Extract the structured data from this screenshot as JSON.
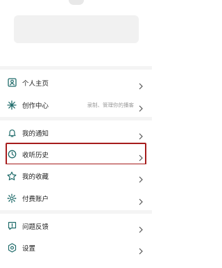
{
  "menu": {
    "items": [
      {
        "label": "个人主页",
        "sub": "",
        "icon": "profile-icon"
      },
      {
        "label": "创作中心",
        "sub": "录制、管理你的播客",
        "icon": "sparkle-icon"
      },
      {
        "label": "我的通知",
        "sub": "",
        "icon": "bell-icon"
      },
      {
        "label": "收听历史",
        "sub": "",
        "icon": "history-icon"
      },
      {
        "label": "我的收藏",
        "sub": "",
        "icon": "star-icon"
      },
      {
        "label": "付费账户",
        "sub": "",
        "icon": "gear-icon"
      },
      {
        "label": "问题反馈",
        "sub": "",
        "icon": "feedback-icon"
      },
      {
        "label": "设置",
        "sub": "",
        "icon": "settings-icon"
      }
    ]
  },
  "colors": {
    "accent": "#1f6b6a",
    "highlight_border": "#a61c1c"
  }
}
